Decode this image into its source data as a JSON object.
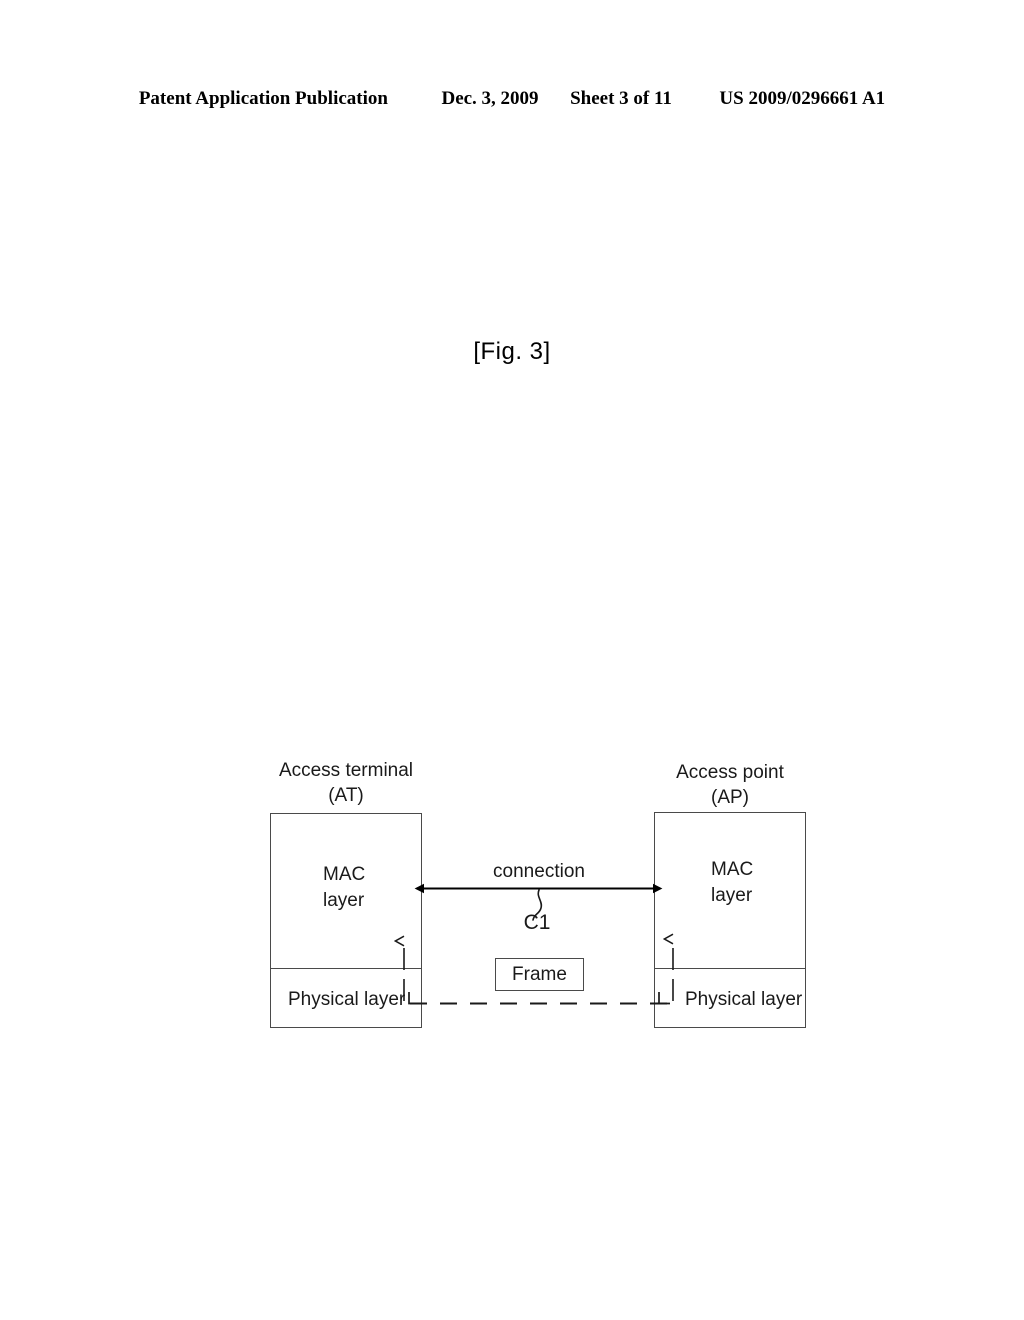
{
  "header": {
    "publication": "Patent Application Publication",
    "date": "Dec. 3, 2009",
    "sheet": "Sheet 3 of 11",
    "patent_number": "US 2009/0296661 A1"
  },
  "figure": {
    "label": "[Fig. 3]"
  },
  "diagram": {
    "type": "protocol-stack-connection",
    "left_node": {
      "title_line1": "Access terminal",
      "title_line2": "(AT)",
      "mac_layer_line1": "MAC",
      "mac_layer_line2": "layer",
      "physical_layer": "Physical layer"
    },
    "right_node": {
      "title_line1": "Access point",
      "title_line2": "(AP)",
      "mac_layer_line1": "MAC",
      "mac_layer_line2": "layer",
      "physical_layer": "Physical layer"
    },
    "connection": {
      "label": "connection",
      "reference": "C1",
      "arrow": "double-headed-horizontal-arrow"
    },
    "frame": {
      "label": "Frame"
    },
    "medium": {
      "style": "dashed-horizontal-line"
    }
  },
  "colors": {
    "ink": "#000000",
    "line": "#4a4a4a",
    "text": "#1a1a1a",
    "background": "#ffffff"
  }
}
